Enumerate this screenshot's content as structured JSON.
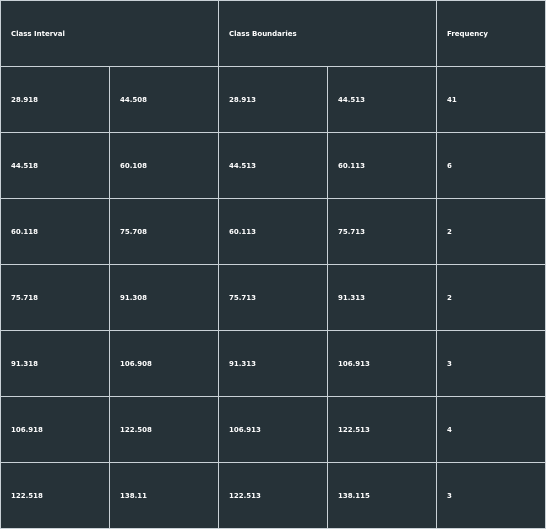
{
  "table": {
    "headers": {
      "class_interval": "Class Interval",
      "class_boundaries": "Class Boundaries",
      "frequency": "Frequency"
    },
    "rows": [
      [
        "28.918",
        "44.508",
        "28.913",
        "44.513",
        "41"
      ],
      [
        "44.518",
        "60.108",
        "44.513",
        "60.113",
        "6"
      ],
      [
        "60.118",
        "75.708",
        "60.113",
        "75.713",
        "2"
      ],
      [
        "75.718",
        "91.308",
        "75.713",
        "91.313",
        "2"
      ],
      [
        "91.318",
        "106.908",
        "91.313",
        "106.913",
        "3"
      ],
      [
        "106.918",
        "122.508",
        "106.913",
        "122.513",
        "4"
      ],
      [
        "122.518",
        "138.11",
        "122.513",
        "138.115",
        "3"
      ]
    ]
  },
  "colors": {
    "background": "#263238",
    "border": "#c9d1d6",
    "text": "#ffffff"
  }
}
